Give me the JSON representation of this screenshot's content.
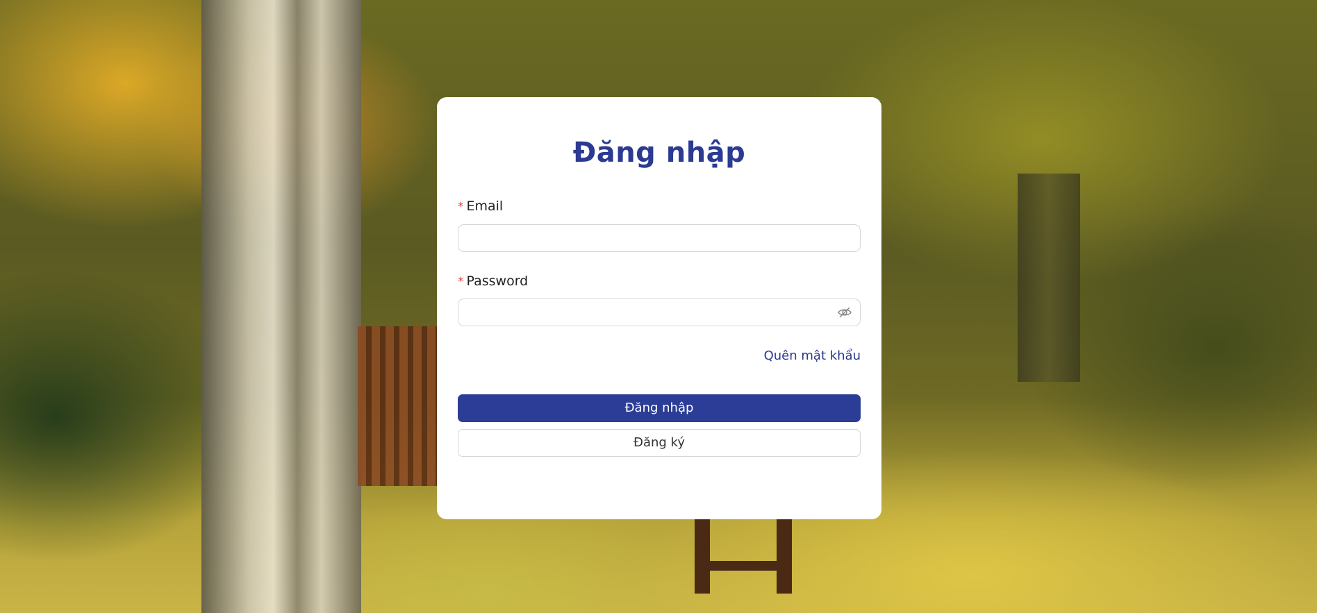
{
  "login": {
    "title": "Đăng nhập",
    "email_label": "Email",
    "email_value": "",
    "password_label": "Password",
    "password_value": "",
    "required_marker": "*",
    "forgot_password": "Quên mật khẩu",
    "submit_label": "Đăng nhập",
    "register_label": "Đăng ký",
    "password_toggle_icon": "eye-slash-icon"
  },
  "colors": {
    "accent": "#2b3a92",
    "required": "#e53935",
    "card_bg": "#ffffff"
  }
}
